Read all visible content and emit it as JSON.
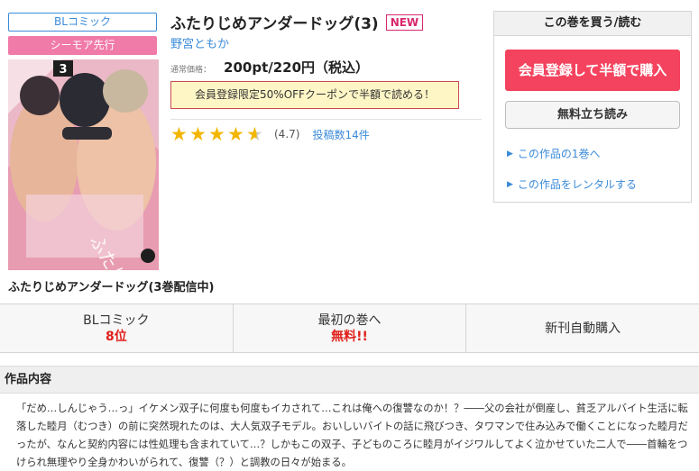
{
  "tags": {
    "genre": "BLコミック",
    "first": "シーモア先行"
  },
  "cover": {
    "volume_number": "3",
    "alt": "ふたりじめアンダードッグ"
  },
  "series_title": "ふたりじめアンダードッグ(3巻配信中)",
  "book": {
    "title": "ふたりじめアンダードッグ(3)",
    "new_badge": "NEW",
    "author": "野宮ともか",
    "price_label": "通常価格：",
    "price": "200pt/220円（税込）",
    "coupon": "会員登録限定50%OFFクーポンで半額で読める！",
    "rating": 4.7,
    "rating_text": "(4.7)",
    "review_count": "投稿数14件"
  },
  "buy_box": {
    "header": "この巻を買う/読む",
    "register_button": "会員登録して半額で購入",
    "trial_button": "無料立ち読み",
    "link_first": "この作品の1巻へ",
    "link_rental": "この作品をレンタルする"
  },
  "stats": [
    {
      "label": "BLコミック",
      "value": "8位"
    },
    {
      "label": "最初の巻へ",
      "value": "無料!!"
    },
    {
      "label": "新刊自動購入",
      "value": ""
    }
  ],
  "section": {
    "title": "作品内容",
    "description": "「だめ…しんじゃう…っ」イケメン双子に何度も何度もイカされて…これは俺への復讐なのか！？――父の会社が倒産し、貧乏アルバイト生活に転落した睦月（むつき）の前に突然現れたのは、大人気双子モデル。おいしいバイトの話に飛びつき、タワマンで住み込みで働くことになった睦月だったが、なんと契約内容には性処理も含まれていて…？しかもこの双子、子どものころに睦月がイジワルしてよく泣かせていた二人で――首輪をつけられ無理やり全身かわいがられて、復讐（？）と調教の日々が始まる。"
  },
  "colors": {
    "accent_blue": "#3b8bd8",
    "accent_pink": "#f07aa8",
    "buy_red": "#f4435e",
    "star": "#f2b600",
    "rank_red": "#e0201a"
  }
}
